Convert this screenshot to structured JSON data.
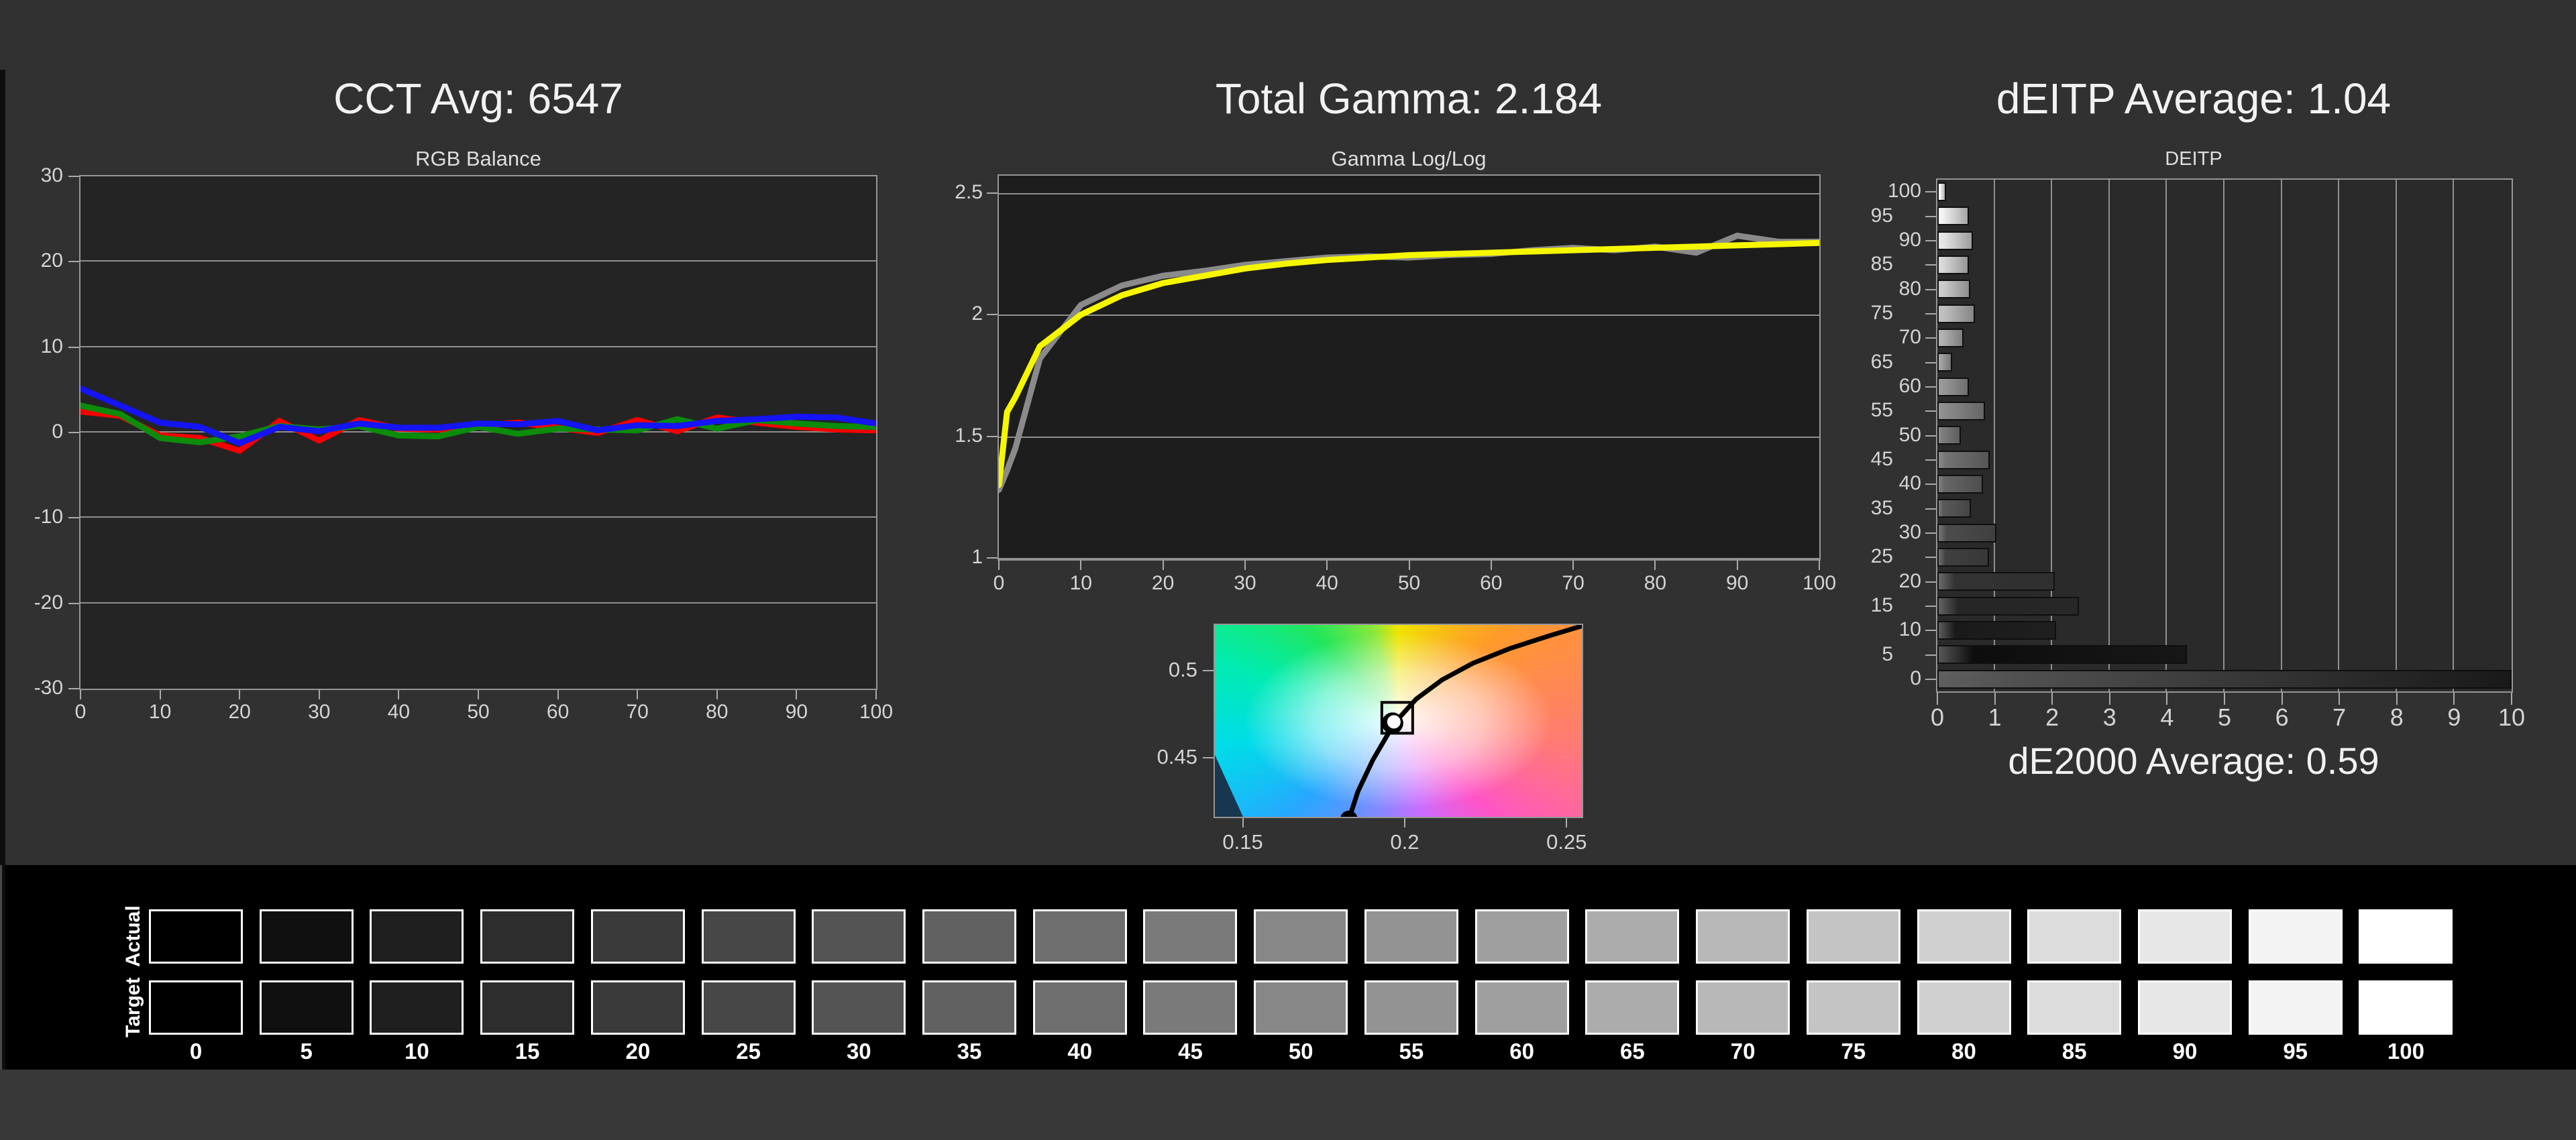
{
  "colors": {
    "page_bg": "#313131",
    "plot_bg_left": "#242424",
    "plot_bg_gamma": "#1d1d1d",
    "plot_bg_deitp": "#2a2a2a",
    "grid": "#8f8f8f",
    "frame": "#969696",
    "axis_text": "#d4d4d4",
    "red": "#f40000",
    "green": "#0b8c0b",
    "blue": "#1414f4",
    "yellow": "#f6f600",
    "measured_gray": "#8a8a8a",
    "locus_black": "#000000",
    "strip_bg": "#000000",
    "below_strip_bg": "#383838"
  },
  "chart_data": [
    {
      "id": "rgb_balance",
      "type": "line",
      "title": "CCT Avg: 6547",
      "subtitle": "RGB Balance",
      "xlabel": "",
      "ylabel": "",
      "ylim": [
        -30,
        30
      ],
      "yticks": [
        30,
        20,
        10,
        0,
        -10,
        -20,
        -30
      ],
      "xticks": [
        0,
        10,
        20,
        30,
        40,
        50,
        60,
        70,
        80,
        90,
        100
      ],
      "x": [
        0,
        5,
        10,
        15,
        20,
        25,
        30,
        35,
        40,
        45,
        50,
        55,
        60,
        65,
        70,
        75,
        80,
        85,
        90,
        95,
        100
      ],
      "series": [
        {
          "name": "Red",
          "color": "#f40000",
          "values": [
            2.3,
            1.8,
            -0.5,
            -0.8,
            -2.3,
            1.2,
            -1.1,
            1.3,
            0.3,
            0.2,
            0.6,
            1.0,
            0.4,
            -0.2,
            1.3,
            0.0,
            1.6,
            1.0,
            0.5,
            0.2,
            0.1
          ]
        },
        {
          "name": "Green",
          "color": "#0b8c0b",
          "values": [
            3.0,
            2.0,
            -0.8,
            -1.3,
            -0.6,
            0.6,
            0.2,
            0.6,
            -0.5,
            -0.6,
            0.5,
            -0.3,
            0.3,
            0.2,
            0.1,
            1.4,
            0.3,
            1.3,
            0.9,
            0.6,
            0.5
          ]
        },
        {
          "name": "Blue",
          "color": "#1414f4",
          "values": [
            5.0,
            3.0,
            1.0,
            0.5,
            -1.4,
            0.5,
            0.0,
            0.9,
            0.4,
            0.4,
            0.9,
            0.8,
            1.2,
            0.1,
            0.7,
            0.6,
            1.2,
            1.4,
            1.7,
            1.6,
            0.9
          ]
        }
      ],
      "grid": true,
      "legend": "none"
    },
    {
      "id": "gamma_loglog",
      "type": "line",
      "title": "Total Gamma: 2.184",
      "subtitle": "Gamma Log/Log",
      "ylim": [
        1,
        2.571
      ],
      "yticks": [
        2.5,
        2,
        1.5,
        1
      ],
      "xticks": [
        0,
        10,
        20,
        30,
        40,
        50,
        60,
        70,
        80,
        90,
        100
      ],
      "x": [
        0,
        1,
        2,
        5,
        10,
        15,
        20,
        25,
        30,
        35,
        40,
        45,
        50,
        55,
        60,
        65,
        70,
        75,
        80,
        85,
        90,
        95,
        100
      ],
      "series": [
        {
          "name": "Measured",
          "color": "#8a8a8a",
          "values": [
            1.28,
            1.36,
            1.45,
            1.82,
            2.04,
            2.12,
            2.16,
            2.18,
            2.205,
            2.22,
            2.235,
            2.24,
            2.235,
            2.245,
            2.25,
            2.265,
            2.275,
            2.265,
            2.28,
            2.255,
            2.325,
            2.3,
            2.3
          ]
        },
        {
          "name": "Target",
          "color": "#f6f600",
          "values": [
            1.3,
            1.6,
            1.66,
            1.87,
            2.0,
            2.08,
            2.13,
            2.16,
            2.19,
            2.21,
            2.225,
            2.235,
            2.245,
            2.25,
            2.255,
            2.26,
            2.265,
            2.27,
            2.275,
            2.28,
            2.285,
            2.29,
            2.295
          ]
        }
      ],
      "grid": true,
      "legend": "none"
    },
    {
      "id": "cie_detail",
      "type": "scatter",
      "title": "",
      "subtitle": "",
      "xlim": [
        0.1414,
        0.2547
      ],
      "ylim": [
        0.4162,
        0.5262
      ],
      "xticks": [
        0.15,
        0.2,
        0.25
      ],
      "yticks": [
        0.5,
        0.45
      ],
      "white_point": [
        0.1975,
        0.4695
      ],
      "locus": [
        [
          0.1832,
          0.414
        ],
        [
          0.186,
          0.43
        ],
        [
          0.1906,
          0.448
        ],
        [
          0.1956,
          0.464
        ],
        [
          0.1979,
          0.4705
        ],
        [
          0.204,
          0.483
        ],
        [
          0.212,
          0.494
        ],
        [
          0.2215,
          0.5035
        ],
        [
          0.233,
          0.512
        ],
        [
          0.245,
          0.5192
        ],
        [
          0.255,
          0.5248
        ]
      ]
    },
    {
      "id": "deitp",
      "type": "bar",
      "title": "dEITP Average: 1.04",
      "subtitle": "DEITP",
      "footer": "dE2000 Average: 0.59",
      "orientation": "horizontal",
      "categories": [
        100,
        95,
        90,
        85,
        80,
        75,
        70,
        65,
        60,
        55,
        50,
        45,
        40,
        35,
        30,
        25,
        20,
        15,
        10,
        5,
        0
      ],
      "values": [
        0.15,
        0.55,
        0.62,
        0.55,
        0.57,
        0.66,
        0.46,
        0.26,
        0.55,
        0.83,
        0.41,
        0.91,
        0.8,
        0.58,
        1.03,
        0.9,
        2.04,
        2.47,
        2.07,
        4.35,
        10
      ],
      "xlim": [
        0,
        10
      ],
      "xticks": [
        0,
        1,
        2,
        3,
        4,
        5,
        6,
        7,
        8,
        9,
        10
      ],
      "grid": true,
      "legend": "none"
    }
  ],
  "ramp": {
    "row_labels": [
      "Actual",
      "Target"
    ],
    "levels": [
      0,
      5,
      10,
      15,
      20,
      25,
      30,
      35,
      40,
      45,
      50,
      55,
      60,
      65,
      70,
      75,
      80,
      85,
      90,
      95,
      100
    ]
  }
}
